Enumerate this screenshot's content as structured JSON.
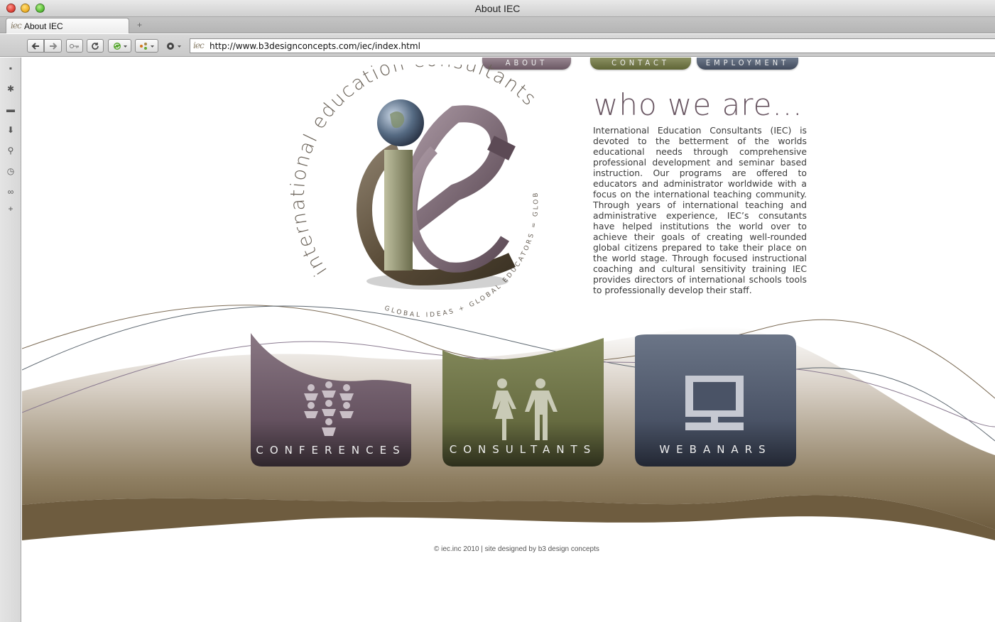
{
  "window": {
    "title": "About IEC"
  },
  "tabs": [
    {
      "label": "About IEC",
      "favicon": "iec-logo-icon"
    }
  ],
  "toolbar": {
    "url": "http://www.b3designconcepts.com/iec/index.html",
    "new_tab_label": "+"
  },
  "site": {
    "nav": {
      "about": "ABOUT",
      "contact": "CONTACT",
      "employment": "EMPLOYMENT"
    },
    "logo": {
      "arc_text": "international education consultants",
      "tagline": "GLOBAL IDEAS + GLOBAL EDUCATORS = GLOBAL CITIZENS",
      "monogram": "IEC"
    },
    "who": {
      "heading": "who we are...",
      "body": "International Education Consultants (IEC) is devoted to the betterment of the worlds educational needs through comprehensive professional development and seminar based instruction. Our programs are offered to educators and administrator worldwide with a focus on the international teaching community. Through years of international teaching and administrative experience, IEC’s consutants have helped institutions the world over to achieve their goals of creating well-rounded global citizens prepared to take their place on the world stage. Through focused instructional coaching and cultural sensitivity training IEC provides directors of international schools tools to professionally develop their staff."
    },
    "cards": [
      {
        "label": "CONFERENCES",
        "icon": "people-group-icon",
        "color": "#6a5763"
      },
      {
        "label": "CONSULTANTS",
        "icon": "man-woman-icon",
        "color": "#6e7145"
      },
      {
        "label": "WEBANARS",
        "icon": "computer-monitor-icon",
        "color": "#4a5366"
      }
    ],
    "footer": "© iec.inc 2010 | site designed by b3 design concepts"
  },
  "colors": {
    "plum": "#6a5763",
    "olive": "#6e7145",
    "slate": "#4a5366",
    "sand": "#7a6a4f"
  }
}
